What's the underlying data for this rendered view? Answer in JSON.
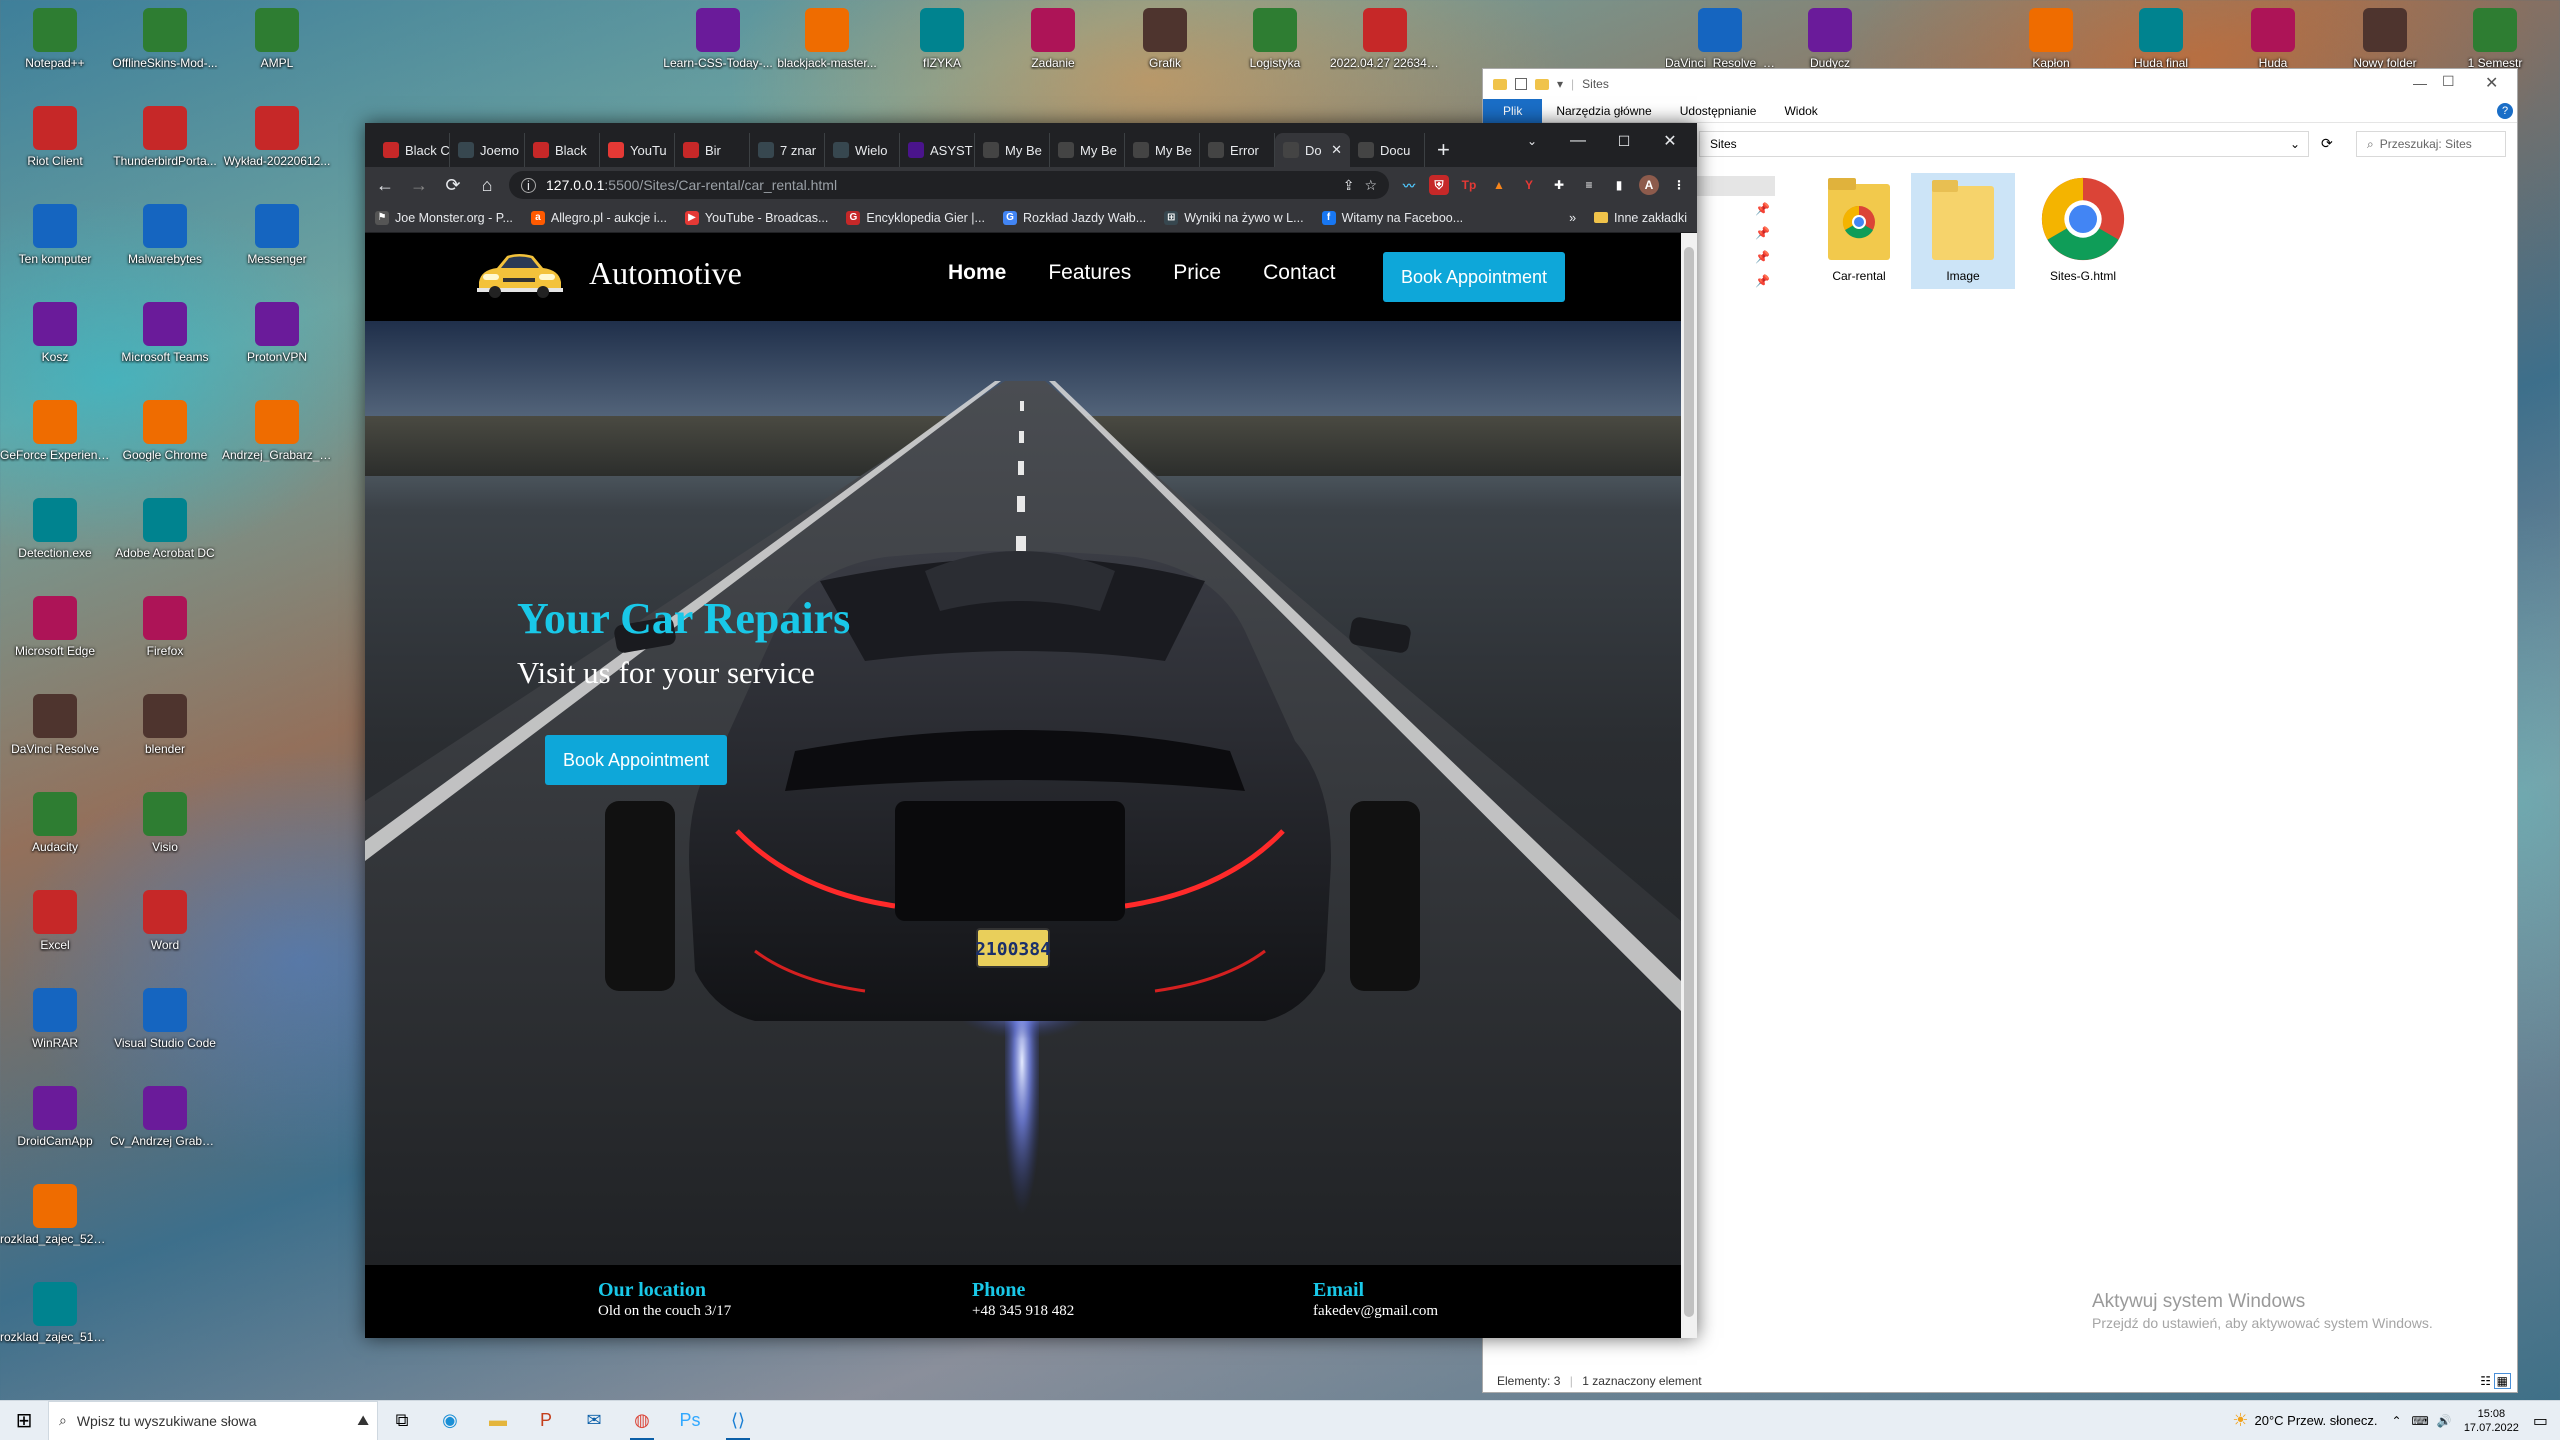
{
  "desktop_icons_col1": [
    "Notepad++",
    "Riot Client",
    "Ten komputer",
    "Kosz",
    "GeForce Experience",
    "Detection.exe",
    "Microsoft Edge",
    "DaVinci Resolve",
    "Audacity",
    "Excel",
    "WinRAR",
    "DroidCamApp",
    "rozklad_zajec_525...",
    "rozklad_zajec_510..."
  ],
  "desktop_icons_col2": [
    "OfflineSkins-Mod-...",
    "ThunderbirdPorta...",
    "Malwarebytes",
    "Microsoft Teams",
    "Google Chrome",
    "Adobe Acrobat DC",
    "Firefox",
    "blender",
    "Visio",
    "Word",
    "Visual Studio Code",
    "Cv_Andrzej Grabarz.pdf"
  ],
  "desktop_icons_col3": [
    "AMPL",
    "Wykład-20220612...",
    "Messenger",
    "ProtonVPN",
    "Andrzej_Grabarz_C..."
  ],
  "desktop_icons_top": [
    "Learn-CSS-Today-...",
    "blackjack-master...",
    "fIZYKA",
    "Zadanie",
    "Grafik",
    "Logistyka",
    "2022.04.27 226348...",
    "DaVinci_Resolve_1...",
    "Dudycz",
    "Kapłon",
    "Huda final",
    "Huda",
    "Nowy folder",
    "1 Semestr"
  ],
  "browser": {
    "tabs": [
      "Black C",
      "Joemo",
      "Black",
      "YouTu",
      "Bir",
      "7 znar",
      "Wielo",
      "ASYST",
      "My Be",
      "My Be",
      "My Be",
      "Error",
      "Do",
      "Docu"
    ],
    "new_tab": "+",
    "url_host": "127.0.0.1",
    "url_path": ":5500/Sites/Car-rental/car_rental.html",
    "profile_letter": "A",
    "bookmarks": [
      "Joe Monster.org - P...",
      "Allegro.pl - aukcje i...",
      "YouTube - Broadcas...",
      "Encyklopedia Gier |...",
      "Rozkład Jazdy Wałb...",
      "Wyniki na żywo w L...",
      "Witamy na Faceboo..."
    ],
    "bookmarks_more": "»",
    "other_bookmarks": "Inne zakładki"
  },
  "site": {
    "brand": "Automotive",
    "nav": [
      "Home",
      "Features",
      "Price",
      "Contact"
    ],
    "nav_cta": "Book Appointment",
    "hero_title": "Your Car Repairs",
    "hero_subtitle": "Visit us for your service",
    "hero_cta": "Book Appointment",
    "plate": "2100384",
    "footer": [
      {
        "heading": "Our location",
        "value": "Old on the couch 3/17"
      },
      {
        "heading": "Phone",
        "value": "+48 345 918 482"
      },
      {
        "heading": "Email",
        "value": "fakedev@gmail.com"
      }
    ]
  },
  "explorer": {
    "title": "Sites",
    "ribbon": [
      "Plik",
      "Narzędzia główne",
      "Udostępnianie",
      "Widok"
    ],
    "address": "Sites",
    "search_placeholder": "Przeszukaj: Sites",
    "items": [
      "Car-rental",
      "Image",
      "Sites-G.html"
    ],
    "status_count": "Elementy: 3",
    "status_selected": "1 zaznaczony element",
    "activate_title": "Aktywuj system Windows",
    "activate_sub": "Przejdź do ustawień, aby aktywować system Windows."
  },
  "taskbar": {
    "search_placeholder": "Wpisz tu wyszukiwane słowa",
    "weather": "20°C  Przew. słonecz.",
    "time": "15:08",
    "date": "17.07.2022"
  },
  "colors": {
    "accent": "#0ea7d9",
    "hero_title": "#19c8e8",
    "explorer_file_tab": "#1a6ec7"
  }
}
